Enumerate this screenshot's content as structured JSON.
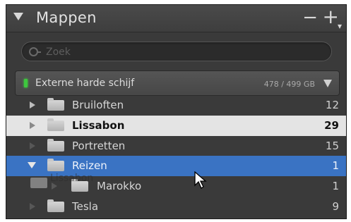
{
  "panel": {
    "title": "Mappen",
    "collapse_icon": "triangle-down-icon",
    "remove_icon": "minus-icon",
    "add_icon": "plus-icon"
  },
  "search": {
    "placeholder": "Zoek",
    "value": ""
  },
  "volume": {
    "name": "Externe harde schijf",
    "size": "478 / 499 GB",
    "status_color": "#3ec83e"
  },
  "folders": [
    {
      "name": "Bruiloften",
      "count": "12",
      "state": "normal"
    },
    {
      "name": "Lissabon",
      "count": "29",
      "state": "selected"
    },
    {
      "name": "Portretten",
      "count": "15",
      "state": "normal"
    },
    {
      "name": "Reizen",
      "count": "1",
      "state": "active",
      "expanded": true
    },
    {
      "name": "Marokko",
      "count": "1",
      "state": "normal",
      "child": true
    },
    {
      "name": "Tesla",
      "count": "9",
      "state": "normal"
    }
  ],
  "drag": {
    "label": "Lissabon"
  },
  "colors": {
    "panel_bg": "#3a3a3a",
    "selected_bg": "#e4e4e4",
    "active_bg": "#3a73c3"
  }
}
